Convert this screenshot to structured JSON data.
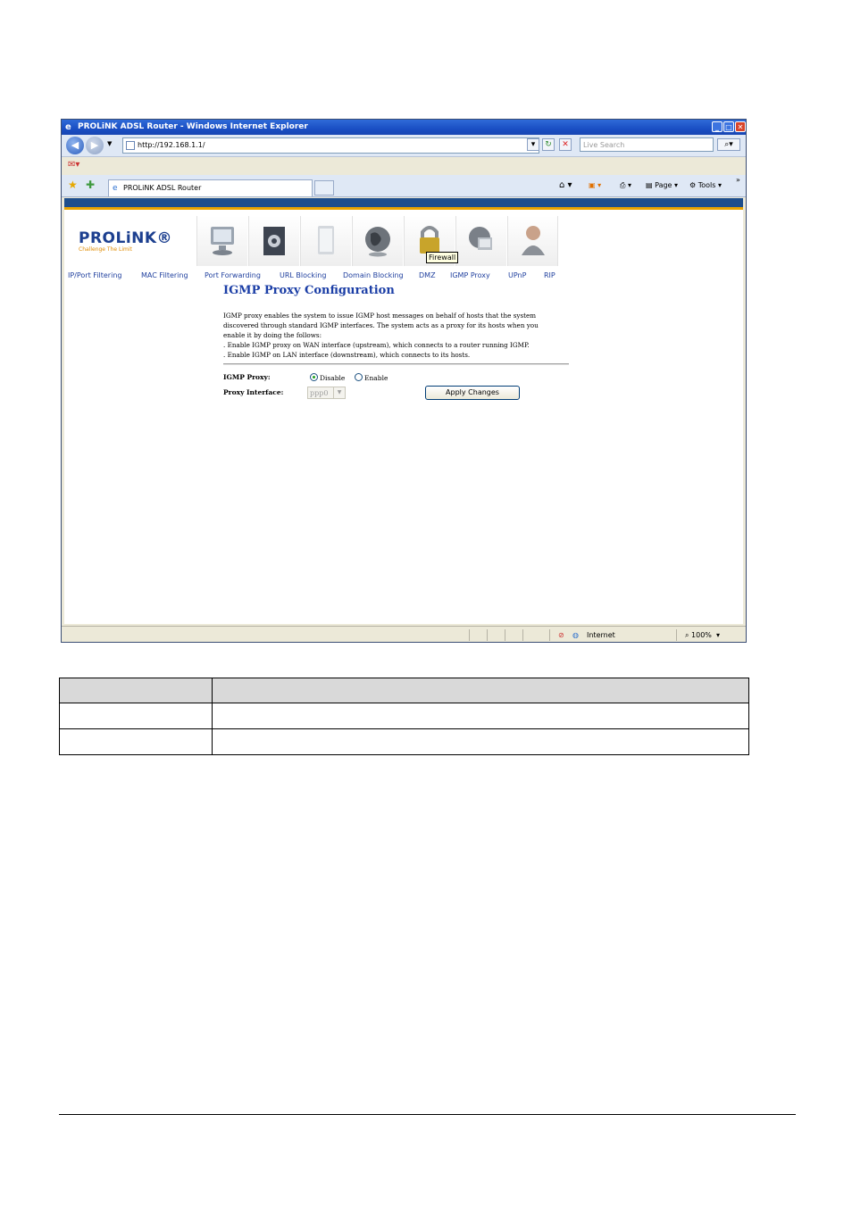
{
  "browser": {
    "title": "PROLiNK ADSL Router - Windows Internet Explorer",
    "address": "http://192.168.1.1/",
    "search_placeholder": "Live Search",
    "tab_label": "PROLiNK ADSL Router",
    "page_menu": "Page",
    "tools_menu": "Tools",
    "chevron": "»"
  },
  "router": {
    "brand": "PROLiNK®",
    "slogan": "Challenge The Limit",
    "tooltip": "Firewall",
    "subnav": [
      "IP/Port Filtering",
      "MAC Filtering",
      "Port Forwarding",
      "URL Blocking",
      "Domain Blocking",
      "DMZ",
      "IGMP Proxy",
      "UPnP",
      "RIP"
    ]
  },
  "page": {
    "title": "IGMP Proxy Configuration",
    "description": [
      "IGMP proxy enables the system to issue IGMP host messages on behalf of hosts that the system",
      "discovered through standard IGMP interfaces. The system acts as a proxy for its hosts when you",
      "enable it by doing the follows:",
      ". Enable IGMP proxy on WAN interface (upstream), which connects to a router running IGMP.",
      ". Enable IGMP on LAN interface (downstream), which connects to its hosts."
    ],
    "igmp_label": "IGMP Proxy:",
    "disable_label": "Disable",
    "enable_label": "Enable",
    "igmp_selected": "Disable",
    "interface_label": "Proxy Interface:",
    "interface_value": "ppp0",
    "apply_label": "Apply Changes"
  },
  "status": {
    "zone": "Internet",
    "zoom": "100%"
  }
}
